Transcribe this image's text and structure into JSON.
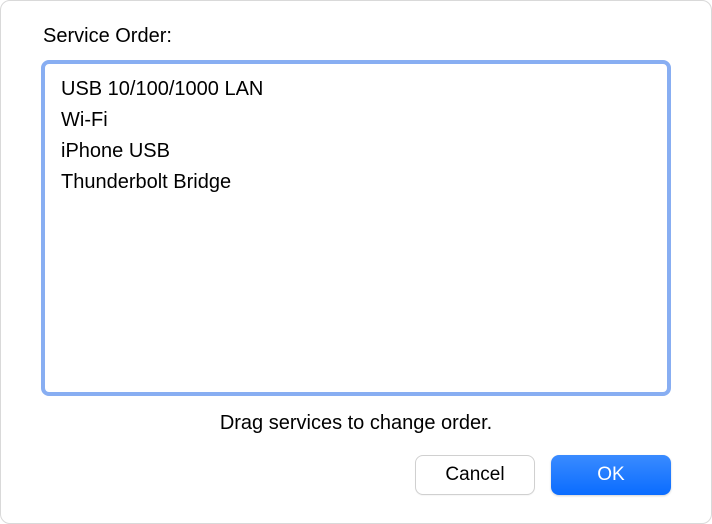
{
  "title": "Service Order:",
  "services": [
    "USB 10/100/1000 LAN",
    "Wi-Fi",
    "iPhone USB",
    "Thunderbolt Bridge"
  ],
  "instruction": "Drag services to change order.",
  "buttons": {
    "cancel": "Cancel",
    "ok": "OK"
  }
}
